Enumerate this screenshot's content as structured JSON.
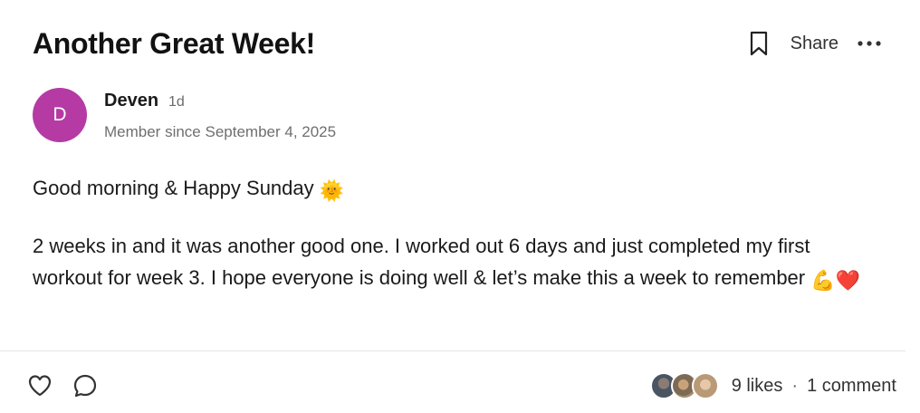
{
  "post": {
    "title": "Another Great Week!",
    "share_label": "Share"
  },
  "author": {
    "initial": "D",
    "name": "Deven",
    "time_ago": "1d",
    "member_since": "Member since September 4, 2025"
  },
  "content": {
    "greeting": "Good morning & Happy Sunday",
    "greeting_emoji": "🌞",
    "body": "2 weeks in and it was another good one. I worked out 6 days and just completed my first workout for week 3. I hope everyone is doing well & let’s make this a week to remember",
    "body_emojis": "💪❤️"
  },
  "footer": {
    "likes": "9 likes",
    "separator": "·",
    "comments": "1 comment"
  },
  "colors": {
    "avatar_bg": "#b53aa4"
  },
  "icons": {
    "bookmark": "bookmark-icon",
    "more": "more-horizontal-icon",
    "like": "heart-icon",
    "comment": "comment-icon"
  }
}
